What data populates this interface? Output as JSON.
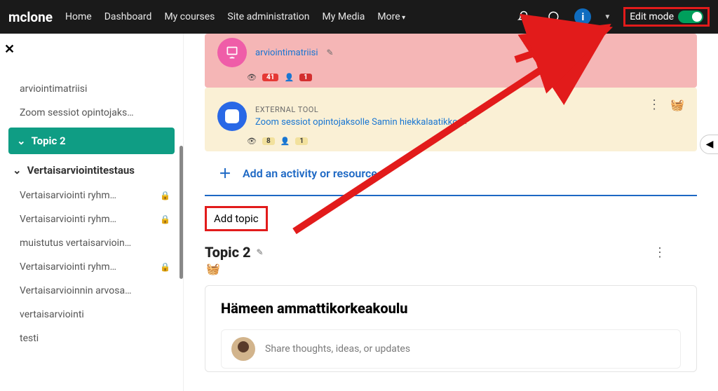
{
  "brand": "mclone",
  "nav": {
    "home": "Home",
    "dashboard": "Dashboard",
    "mycourses": "My courses",
    "siteadmin": "Site administration",
    "mymedia": "My Media",
    "more": "More"
  },
  "editmode_label": "Edit mode",
  "sidebar": {
    "items": {
      "arvio": "arviointimatriisi",
      "zoom": "Zoom sessiot opintojaks…",
      "topic2": "Topic 2",
      "verta_group": "Vertaisarviointitestaus",
      "v1": "Vertaisarviointi ryhm…",
      "v2": "Vertaisarviointi ryhm…",
      "muistutus": "muistutus vertaisarvioin…",
      "v3": "Vertaisarviointi ryhm…",
      "arvosa": "Vertaisarvioinnin arvosa…",
      "plain": "vertaisarviointi",
      "testi": "testi"
    }
  },
  "card1": {
    "title": "arviointimatriisi",
    "count1": "41",
    "count2": "1"
  },
  "card2": {
    "type": "EXTERNAL TOOL",
    "title": "Zoom sessiot opintojaksolle Samin hiekkalaatikko",
    "count1": "8",
    "count2": "1"
  },
  "add_activity": "Add an activity or resource",
  "add_topic": "Add topic",
  "topic2_title": "Topic 2",
  "forum_title": "Hämeen ammattikorkeakoulu",
  "post_placeholder": "Share thoughts, ideas, or updates"
}
